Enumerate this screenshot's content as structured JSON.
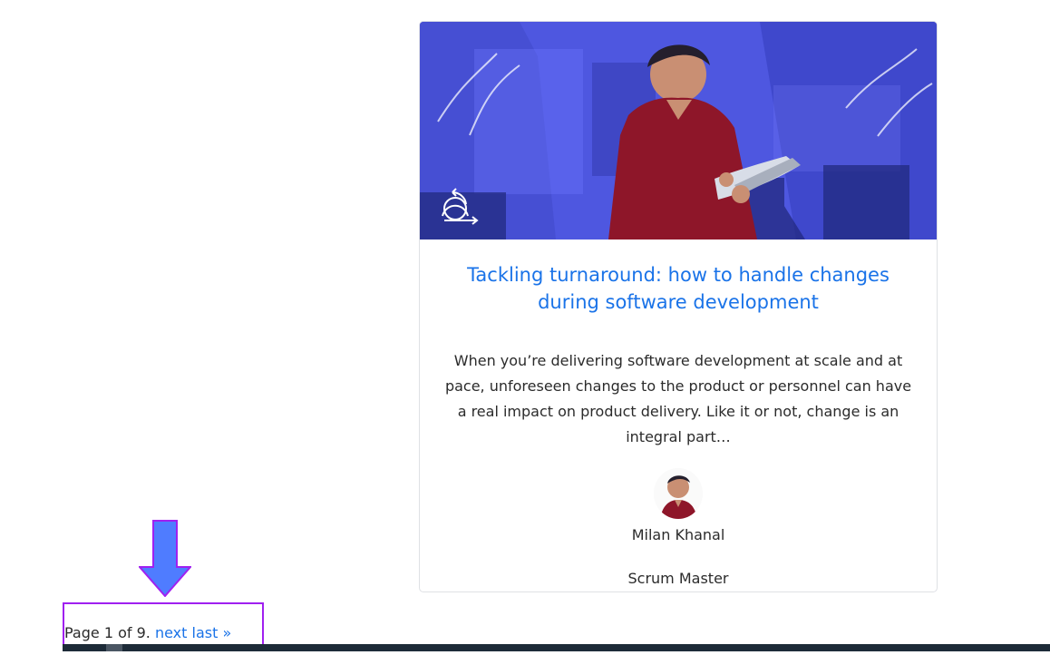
{
  "post": {
    "title_line_1": "Tackling turnaround: how to handle changes",
    "title_line_2": "during software development",
    "excerpt": "When you’re delivering software development at scale and at pace, unforeseen changes to the product or personnel can have a real impact on product delivery. Like it or not, change is an integral part…",
    "author_name": "Milan Khanal",
    "author_role": "Scrum Master"
  },
  "pagination": {
    "status": "Page 1 of 9.",
    "next_label": "next",
    "last_label": "last »"
  },
  "colors": {
    "link": "#1a73e8",
    "hero_overlay": "#4850d8",
    "annotation_box": "#a020f0",
    "annotation_arrow": "#4f7cff",
    "footer": "#1d2b38"
  },
  "icons": {
    "hero_badge": "agile-person-icon",
    "annotation_arrow": "down-arrow-icon"
  }
}
